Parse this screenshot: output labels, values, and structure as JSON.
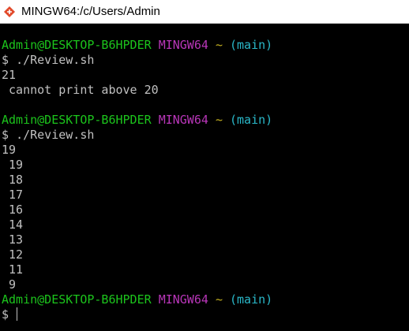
{
  "window": {
    "title": "MINGW64:/c/Users/Admin"
  },
  "colors": {
    "background": "#000000",
    "text": "#c0c0c0",
    "user_host": "#1cc41c",
    "system": "#b936b9",
    "path": "#c4b020",
    "branch": "#2ab8c9"
  },
  "prompt": {
    "user_host": "Admin@DESKTOP-B6HPDER",
    "system": "MINGW64",
    "path": "~",
    "branch": "(main)",
    "symbol": "$"
  },
  "session": [
    {
      "command": "./Review.sh",
      "output": [
        "21",
        " cannot print above 20"
      ]
    },
    {
      "command": "./Review.sh",
      "output": [
        "19",
        " 19",
        " 18",
        " 17",
        " 16",
        " 14",
        " 13",
        " 12",
        " 11",
        " 9"
      ]
    }
  ]
}
